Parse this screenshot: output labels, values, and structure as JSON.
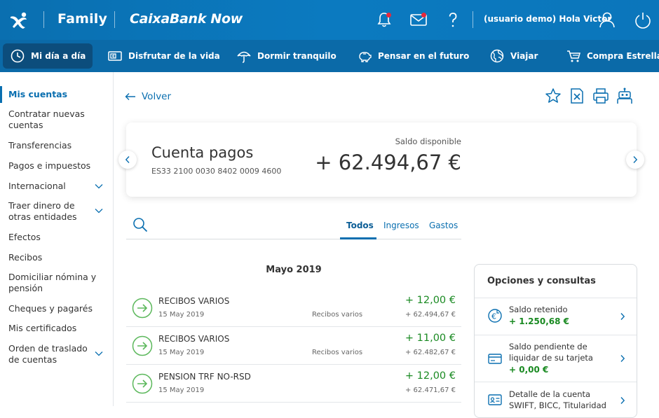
{
  "header": {
    "brand_family": "Family",
    "brand_now": "CaixaBank Now",
    "user_greeting": "(usuario demo) Hola Victor",
    "icons": [
      "bell-icon",
      "mail-icon",
      "help-icon",
      "user-icon",
      "power-icon"
    ]
  },
  "nav": {
    "items": [
      {
        "label": "Mi día a día",
        "icon": "clock-icon",
        "active": true
      },
      {
        "label": "Disfrutar de la vida",
        "icon": "money-card-icon"
      },
      {
        "label": "Dormir tranquilo",
        "icon": "umbrella-icon"
      },
      {
        "label": "Pensar en el futuro",
        "icon": "piggy-bank-icon"
      },
      {
        "label": "Viajar",
        "icon": "globe-icon"
      },
      {
        "label": "Compra Estrella",
        "icon": "cart-icon"
      }
    ]
  },
  "sidebar": {
    "items": [
      {
        "label": "Mis cuentas",
        "active": true
      },
      {
        "label": "Contratar nuevas cuentas"
      },
      {
        "label": "Transferencias"
      },
      {
        "label": "Pagos e impuestos"
      },
      {
        "label": "Internacional",
        "expandable": true
      },
      {
        "label": "Traer dinero de otras entidades",
        "expandable": true
      },
      {
        "label": "Efectos"
      },
      {
        "label": "Recibos"
      },
      {
        "label": "Domiciliar nómina y pensión"
      },
      {
        "label": "Cheques y pagarés"
      },
      {
        "label": "Mis certificados"
      },
      {
        "label": "Orden de traslado de cuentas",
        "expandable": true
      }
    ]
  },
  "main": {
    "back_label": "Volver",
    "toolbar_icons": [
      "star-icon",
      "excel-icon",
      "print-icon",
      "robot-icon"
    ],
    "account": {
      "name": "Cuenta pagos",
      "iban": "ES33 2100 0030 8402 0009 4600",
      "balance_label": "Saldo disponible",
      "balance": "+ 62.494,67 €"
    },
    "tabs": [
      {
        "label": "Todos",
        "active": true
      },
      {
        "label": "Ingresos"
      },
      {
        "label": "Gastos"
      }
    ],
    "month": "Mayo 2019",
    "transactions": [
      {
        "title": "RECIBOS VARIOS",
        "date": "15 May 2019",
        "category": "Recibos varios",
        "amount": "+ 12,00 €",
        "balance": "+ 62.494,67 €"
      },
      {
        "title": "RECIBOS VARIOS",
        "date": "15 May 2019",
        "category": "Recibos varios",
        "amount": "+ 11,00 €",
        "balance": "+ 62.482,67 €"
      },
      {
        "title": "PENSION TRF NO-RSD",
        "date": "15 May 2019",
        "category": "",
        "amount": "+ 12,00 €",
        "balance": "+ 62.471,67 €"
      }
    ],
    "options": {
      "title": "Opciones y consultas",
      "rows": [
        {
          "label": "Saldo retenido",
          "value": "+ 1.250,68 €",
          "icon": "euro-clock-icon"
        },
        {
          "label": "Saldo pendiente de liquidar de su tarjeta",
          "value": "+ 0,00 €",
          "icon": "card-icon"
        },
        {
          "label": "Detalle de la cuenta SWIFT, BICC, Titularidad",
          "value": "",
          "icon": "id-card-icon"
        }
      ]
    }
  },
  "colors": {
    "primary": "#0a6fb0",
    "nav_bg": "#0b6aa8",
    "nav_active": "#0c4d7c",
    "positive": "#1a8a22",
    "notification": "#e8283c"
  }
}
